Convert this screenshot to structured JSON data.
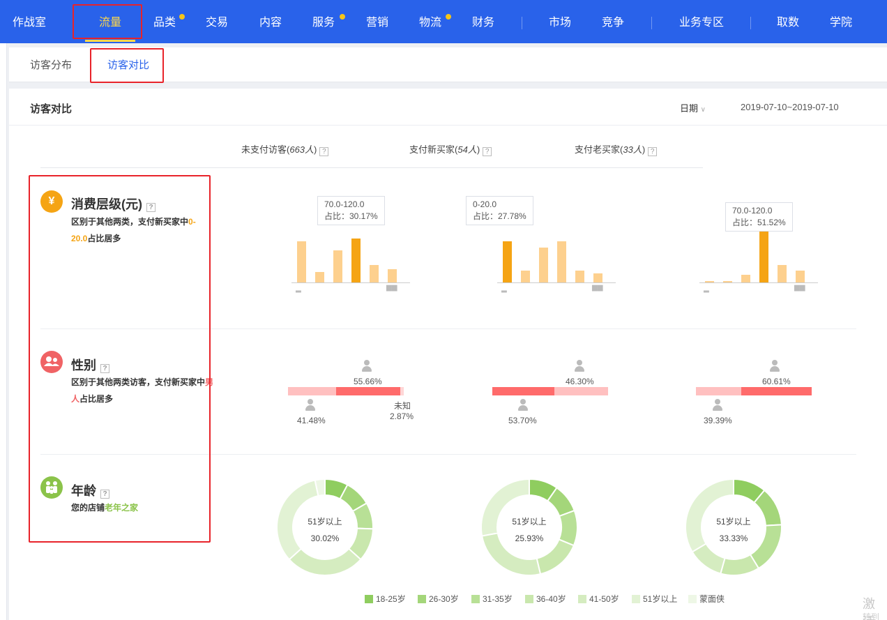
{
  "nav": {
    "items": [
      {
        "label": "作战室"
      },
      {
        "label": "流量"
      },
      {
        "label": "品类"
      },
      {
        "label": "交易"
      },
      {
        "label": "内容"
      },
      {
        "label": "服务"
      },
      {
        "label": "营销"
      },
      {
        "label": "物流"
      },
      {
        "label": "财务"
      },
      {
        "label": "市场"
      },
      {
        "label": "竞争"
      },
      {
        "label": "业务专区"
      },
      {
        "label": "取数"
      },
      {
        "label": "学院"
      }
    ],
    "active": "流量",
    "accent_color": "#ffd84a",
    "bg_color": "#2962ea"
  },
  "tabs": [
    {
      "label": "访客分布"
    },
    {
      "label": "访客对比"
    }
  ],
  "card": {
    "title": "访客对比",
    "date_label": "日期",
    "date_range": "2019-07-10~2019-07-10"
  },
  "columns": [
    {
      "label": "未支付访客(",
      "count": "663人",
      "close": ")"
    },
    {
      "label": "支付新买家(",
      "count": "54人",
      "close": ")"
    },
    {
      "label": "支付老买家(",
      "count": "33人",
      "close": ")"
    }
  ],
  "sections": {
    "spend": {
      "title": "消费层级(元)",
      "icon": "yen-icon",
      "desc_pre": "区别于其他两类，支付新买家中",
      "desc_hl": "0-20.0",
      "desc_post": "占比居多"
    },
    "gender": {
      "title": "性别",
      "icon": "people-icon",
      "desc_pre": "区别于其他两类访客，支付新买家中",
      "desc_hl": "男人",
      "desc_post": "占比居多"
    },
    "age": {
      "title": "年龄",
      "icon": "family-icon",
      "desc_pre": "您的店铺",
      "desc_hl": "老年之家"
    }
  },
  "chart_data": [
    {
      "type": "bar",
      "title": "消费层级(元) - 未支付访客",
      "values": [
        0.28,
        0.07,
        0.22,
        0.3,
        0.12,
        0.09
      ],
      "highlight_index": 3,
      "tooltip": {
        "range": "70.0-120.0",
        "ratio": "占比：30.17%"
      }
    },
    {
      "type": "bar",
      "title": "消费层级(元) - 支付新买家",
      "values": [
        0.28,
        0.08,
        0.24,
        0.28,
        0.08,
        0.06
      ],
      "highlight_index": 0,
      "tooltip": {
        "range": "0-20.0",
        "ratio": "占比：27.78%"
      }
    },
    {
      "type": "bar",
      "title": "消费层级(元) - 支付老买家",
      "values": [
        0.01,
        0.01,
        0.05,
        0.52,
        0.12,
        0.08
      ],
      "highlight_index": 3,
      "tooltip": {
        "range": "70.0-120.0",
        "ratio": "占比：51.52%"
      }
    },
    {
      "type": "bar",
      "title": "性别",
      "series": [
        {
          "name": "男",
          "values": [
            55.66,
            46.3,
            60.61
          ]
        },
        {
          "name": "女",
          "values": [
            41.48,
            53.7,
            39.39
          ]
        },
        {
          "name": "未知",
          "values": [
            2.87,
            0,
            0
          ]
        }
      ],
      "labels": {
        "male": [
          "55.66%",
          "46.30%",
          "60.61%"
        ],
        "female": [
          "41.48%",
          "53.70%",
          "39.39%"
        ],
        "unknown_name": "未知",
        "unknown": "2.87%"
      }
    },
    {
      "type": "pie",
      "title": "年龄",
      "categories": [
        "18-25岁",
        "26-30岁",
        "31-35岁",
        "36-40岁",
        "41-50岁",
        "51岁以上",
        "蒙面侠"
      ],
      "colors": [
        "#8fcd5f",
        "#a4d67a",
        "#b8e096",
        "#c9e7ad",
        "#d5ecc0",
        "#e2f2d4",
        "#eef7e6"
      ],
      "series": [
        {
          "name": "未支付访客",
          "values": [
            7,
            8,
            8,
            10,
            24,
            30.02,
            3
          ],
          "center_label": "51岁以上",
          "center_value": "30.02%"
        },
        {
          "name": "支付新买家",
          "values": [
            9,
            9,
            11,
            14,
            24,
            25.93,
            0
          ],
          "center_label": "51岁以上",
          "center_value": "25.93%"
        },
        {
          "name": "支付老买家",
          "values": [
            11,
            13,
            17,
            13,
            12,
            33.33,
            0
          ],
          "center_label": "51岁以上",
          "center_value": "33.33%"
        }
      ]
    }
  ],
  "watermark": {
    "line1": "激活",
    "line2": "转到"
  }
}
